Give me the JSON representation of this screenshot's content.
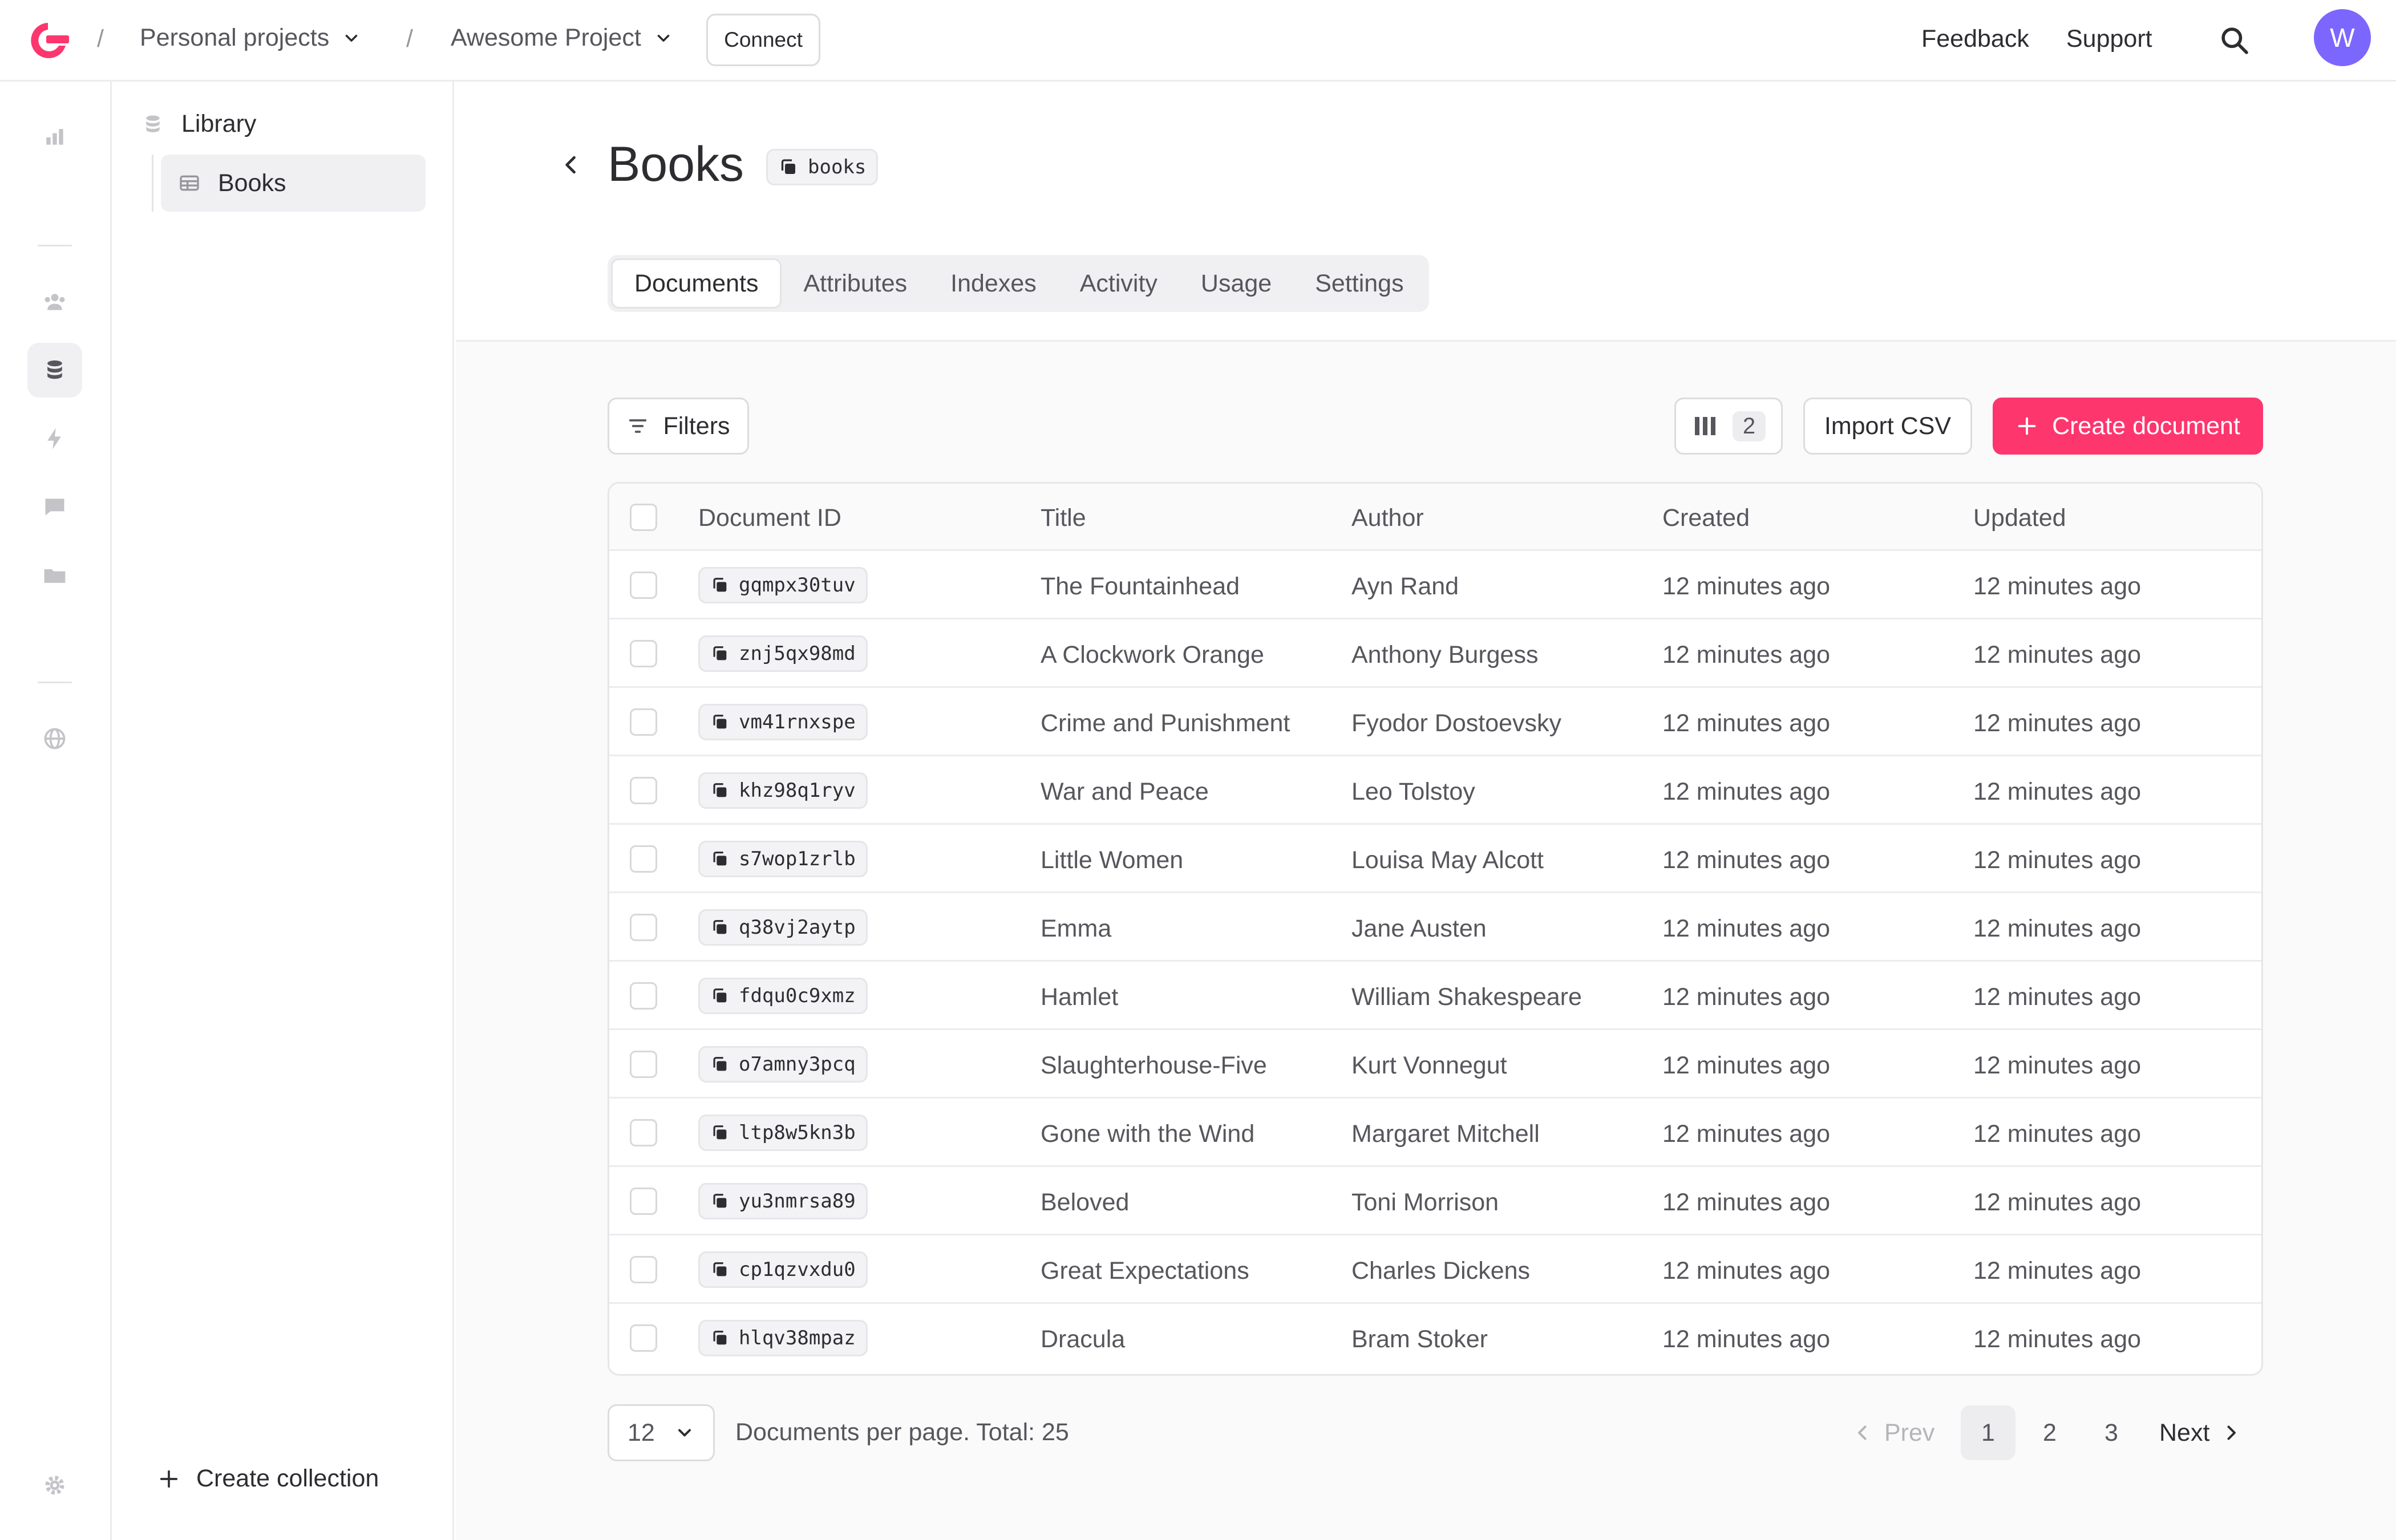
{
  "topbar": {
    "breadcrumb_org": "Personal projects",
    "breadcrumb_project": "Awesome Project",
    "separator": "/",
    "connect_label": "Connect",
    "feedback_label": "Feedback",
    "support_label": "Support",
    "avatar_initial": "W"
  },
  "rail": {
    "icons": [
      "overview-icon",
      "auth-icon",
      "databases-icon",
      "functions-icon",
      "messaging-icon",
      "storage-icon",
      "settings-globe-icon",
      "settings-gear-icon"
    ],
    "active": "databases-icon"
  },
  "sidebar": {
    "database_name": "Library",
    "collections": [
      {
        "label": "Books",
        "active": true
      }
    ],
    "create_label": "Create collection"
  },
  "header": {
    "title": "Books",
    "collection_id": "books",
    "tabs": [
      {
        "label": "Documents",
        "active": true
      },
      {
        "label": "Attributes"
      },
      {
        "label": "Indexes"
      },
      {
        "label": "Activity"
      },
      {
        "label": "Usage"
      },
      {
        "label": "Settings"
      }
    ]
  },
  "toolbar": {
    "filters_label": "Filters",
    "columns_count": "2",
    "import_label": "Import CSV",
    "create_label": "Create document"
  },
  "table": {
    "columns": [
      "Document ID",
      "Title",
      "Author",
      "Created",
      "Updated"
    ],
    "rows": [
      {
        "id": "gqmpx30tuv",
        "title": "The Fountainhead",
        "author": "Ayn Rand",
        "created": "12 minutes ago",
        "updated": "12 minutes ago"
      },
      {
        "id": "znj5qx98md",
        "title": "A Clockwork Orange",
        "author": "Anthony Burgess",
        "created": "12 minutes ago",
        "updated": "12 minutes ago"
      },
      {
        "id": "vm41rnxspe",
        "title": "Crime and Punishment",
        "author": "Fyodor Dostoevsky",
        "created": "12 minutes ago",
        "updated": "12 minutes ago"
      },
      {
        "id": "khz98q1ryv",
        "title": "War and Peace",
        "author": "Leo Tolstoy",
        "created": "12 minutes ago",
        "updated": "12 minutes ago"
      },
      {
        "id": "s7wop1zrlb",
        "title": "Little Women",
        "author": "Louisa May Alcott",
        "created": "12 minutes ago",
        "updated": "12 minutes ago"
      },
      {
        "id": "q38vj2aytp",
        "title": "Emma",
        "author": "Jane Austen",
        "created": "12 minutes ago",
        "updated": "12 minutes ago"
      },
      {
        "id": "fdqu0c9xmz",
        "title": "Hamlet",
        "author": "William Shakespeare",
        "created": "12 minutes ago",
        "updated": "12 minutes ago"
      },
      {
        "id": "o7amny3pcq",
        "title": "Slaughterhouse-Five",
        "author": "Kurt Vonnegut",
        "created": "12 minutes ago",
        "updated": "12 minutes ago"
      },
      {
        "id": "ltp8w5kn3b",
        "title": "Gone with the Wind",
        "author": "Margaret Mitchell",
        "created": "12 minutes ago",
        "updated": "12 minutes ago"
      },
      {
        "id": "yu3nmrsa89",
        "title": "Beloved",
        "author": "Toni Morrison",
        "created": "12 minutes ago",
        "updated": "12 minutes ago"
      },
      {
        "id": "cp1qzvxdu0",
        "title": "Great Expectations",
        "author": "Charles Dickens",
        "created": "12 minutes ago",
        "updated": "12 minutes ago"
      },
      {
        "id": "hlqv38mpaz",
        "title": "Dracula",
        "author": "Bram Stoker",
        "created": "12 minutes ago",
        "updated": "12 minutes ago"
      }
    ]
  },
  "pagination": {
    "per_page": "12",
    "summary": "Documents per page. Total: 25",
    "prev_label": "Prev",
    "next_label": "Next",
    "pages": [
      "1",
      "2",
      "3"
    ],
    "current": "1"
  },
  "colors": {
    "brand": "#fd366e",
    "avatar": "#7c67fe"
  }
}
